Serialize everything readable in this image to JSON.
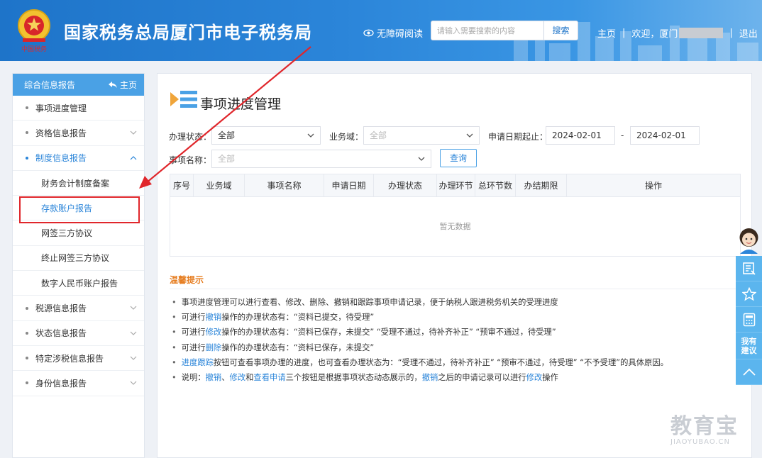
{
  "header": {
    "site_title": "国家税务总局厦门市电子税务局",
    "accessibility": "无障碍阅读",
    "search_placeholder": "请输入需要搜索的内容",
    "search_button": "搜索",
    "nav_home": "主页",
    "welcome": "欢迎，厦门",
    "logout": "退出",
    "separator": "|"
  },
  "sidebar": {
    "head_title": "综合信息报告",
    "head_home": "主页",
    "items": [
      {
        "label": "事项进度管理"
      },
      {
        "label": "资格信息报告"
      },
      {
        "label": "制度信息报告"
      },
      {
        "label": "税源信息报告"
      },
      {
        "label": "状态信息报告"
      },
      {
        "label": "特定涉税信息报告"
      },
      {
        "label": "身份信息报告"
      }
    ],
    "sub_items": [
      {
        "label": "财务会计制度备案"
      },
      {
        "label": "存款账户报告"
      },
      {
        "label": "网签三方协议"
      },
      {
        "label": "终止网签三方协议"
      },
      {
        "label": "数字人民币账户报告"
      }
    ]
  },
  "main": {
    "title": "事项进度管理",
    "filters": {
      "status_label": "办理状态：",
      "status_value": "全部",
      "domain_label": "业务域：",
      "domain_value": "全部",
      "date_label": "申请日期起止：",
      "date_start": "2024-02-01",
      "date_sep": "-",
      "date_end": "2024-02-01",
      "name_label": "事项名称：",
      "name_value": "全部",
      "query_button": "查询"
    },
    "table": {
      "headers": [
        "序号",
        "业务域",
        "事项名称",
        "申请日期",
        "办理状态",
        "办理环节",
        "总环节数",
        "办结期限",
        "操作"
      ],
      "empty_text": "暂无数据"
    },
    "tips": {
      "title": "温馨提示",
      "l1": "事项进度管理可以进行查看、修改、删除、撤销和跟踪事项申请记录，便于纳税人跟进税务机关的受理进度",
      "l2a": "可进行",
      "l2b": "撤销",
      "l2c": "操作的办理状态有：“资料已提交，待受理”",
      "l3a": "可进行",
      "l3b": "修改",
      "l3c": "操作的办理状态有：“资料已保存，未提交” “受理不通过，待补齐补正” “预审不通过，待受理”",
      "l4a": "可进行",
      "l4b": "删除",
      "l4c": "操作的办理状态有：“资料已保存，未提交”",
      "l5a": "进度跟踪",
      "l5b": "按钮可查看事项办理的进度，也可查看办理状态为：“受理不通过，待补齐补正” “预审不通过，待受理” “不予受理”的具体原因。",
      "l6a": "说明：",
      "l6b": "撤销",
      "l6c": "、",
      "l6d": "修改",
      "l6e": "和",
      "l6f": "查看申请",
      "l6g": "三个按钮是根据事项状态动态展示的，",
      "l6h": "撤销",
      "l6i": "之后的申请记录可以进行",
      "l6j": "修改",
      "l6k": "操作"
    }
  },
  "float_bar": {
    "suggest_l1": "我有",
    "suggest_l2": "建议"
  },
  "watermark": {
    "brand": "教育宝",
    "url": "JIAOYUBAO.CN"
  },
  "colors": {
    "header_blue": "#2b85d9",
    "link_blue": "#2b85d9",
    "highlight_red": "#e0262b",
    "tips_orange": "#e67e22"
  }
}
